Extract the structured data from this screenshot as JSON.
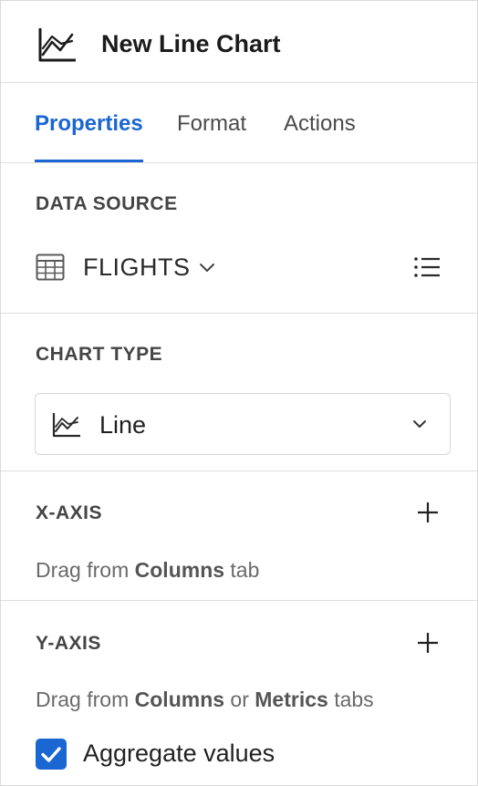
{
  "header": {
    "title": "New Line Chart",
    "icon": "line-chart-icon"
  },
  "tabs": [
    {
      "label": "Properties",
      "active": true
    },
    {
      "label": "Format",
      "active": false
    },
    {
      "label": "Actions",
      "active": false
    }
  ],
  "data_source": {
    "section_title": "DATA SOURCE",
    "name": "FLIGHTS",
    "icon": "table-icon",
    "menu_icon": "list-icon"
  },
  "chart_type": {
    "section_title": "CHART TYPE",
    "selected": "Line",
    "icon": "line-chart-icon"
  },
  "x_axis": {
    "section_title": "X-AXIS",
    "hint_prefix": "Drag from ",
    "hint_bold_1": "Columns",
    "hint_suffix": " tab"
  },
  "y_axis": {
    "section_title": "Y-AXIS",
    "hint_prefix": "Drag from ",
    "hint_bold_1": "Columns",
    "hint_middle": " or ",
    "hint_bold_2": "Metrics",
    "hint_suffix": " tabs"
  },
  "aggregate": {
    "label": "Aggregate values",
    "checked": true
  },
  "colors": {
    "accent": "#1a66d2",
    "border": "#dedede",
    "text": "#222222",
    "muted": "#6a6a6a"
  }
}
